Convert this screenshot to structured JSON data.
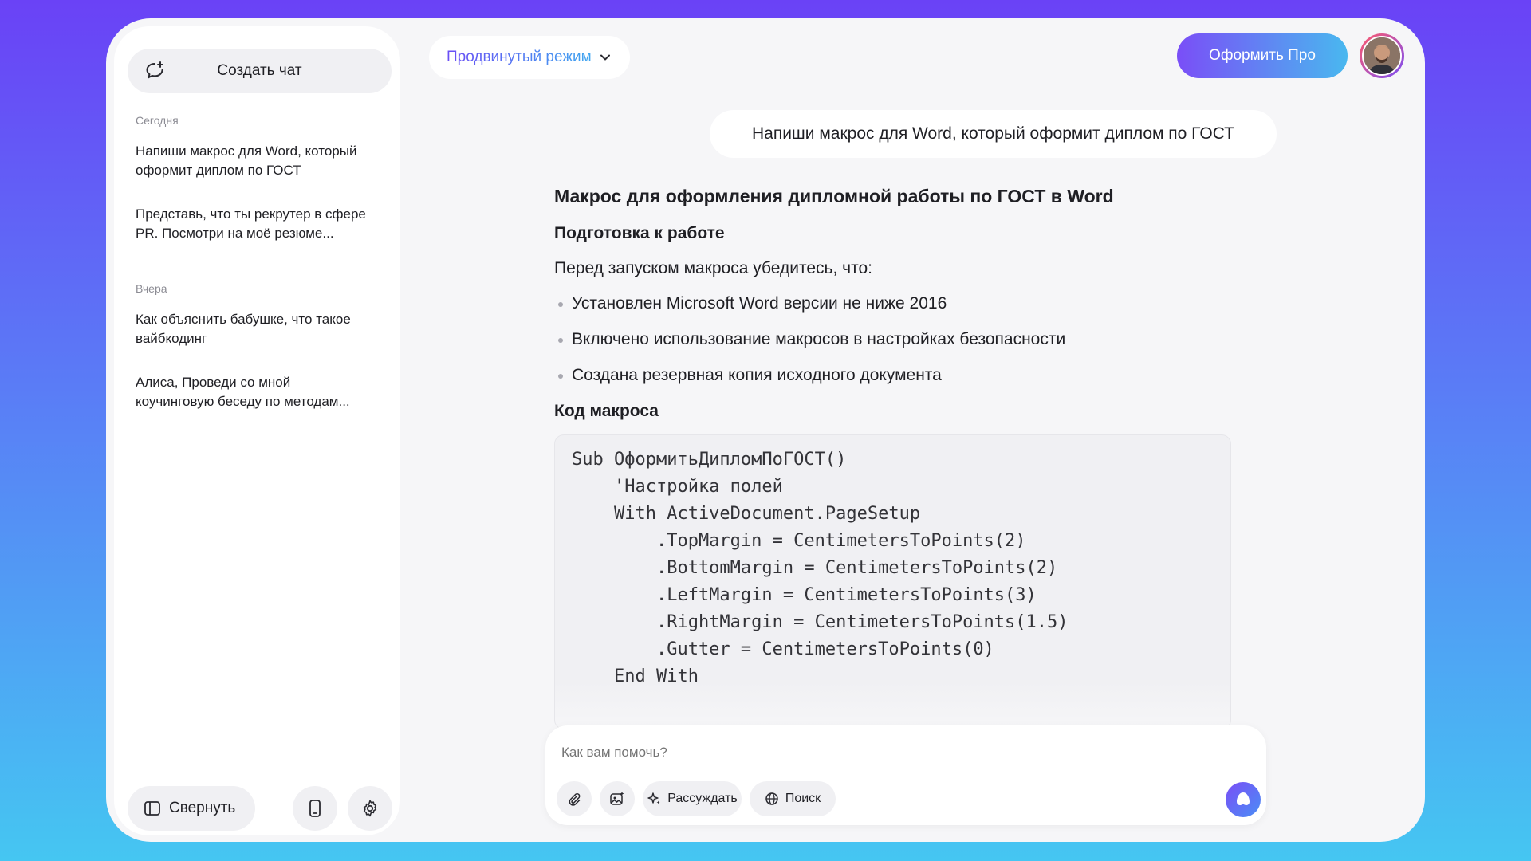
{
  "sidebar": {
    "new_chat_label": "Создать чат",
    "today_label": "Сегодня",
    "yesterday_label": "Вчера",
    "today_items": [
      {
        "line1": "Напиши макрос для Word, который",
        "line2": "оформит диплом по ГОСТ"
      },
      {
        "line1": "Представь, что ты рекрутер в сфере",
        "line2": "PR. Посмотри на моё резюме..."
      }
    ],
    "yesterday_items": [
      {
        "line1": "Как объяснить бабушке, что такое",
        "line2": "вайбкодинг"
      },
      {
        "line1": "Алиса, Проведи со мной",
        "line2": "коучинговую беседу по методам..."
      }
    ],
    "collapse_label": "Свернуть"
  },
  "header": {
    "mode_label": "Продвинутый режим",
    "pro_label": "Оформить Про"
  },
  "chat": {
    "user_message": "Напиши макрос для Word, который оформит диплом по ГОСТ",
    "answer": {
      "title": "Макрос для оформления дипломной работы по ГОСТ в Word",
      "section1": "Подготовка к работе",
      "intro": "Перед запуском макроса убедитесь, что:",
      "bullets": [
        "Установлен Microsoft Word версии не ниже 2016",
        "Включено использование макросов в настройках безопасности",
        "Создана резервная копия исходного документа"
      ],
      "section2": "Код макроса",
      "code": "Sub ОформитьДипломПоГОСТ()\n    'Настройка полей\n    With ActiveDocument.PageSetup\n        .TopMargin = CentimetersToPoints(2)\n        .BottomMargin = CentimetersToPoints(2)\n        .LeftMargin = CentimetersToPoints(3)\n        .RightMargin = CentimetersToPoints(1.5)\n        .Gutter = CentimetersToPoints(0)\n    End With"
    }
  },
  "input": {
    "placeholder": "Как вам помочь?",
    "reason_label": "Рассуждать",
    "search_label": "Поиск"
  },
  "icons": {
    "new_chat": "chat-plus-icon",
    "collapse": "sidebar-panel-icon",
    "phone": "phone-icon",
    "settings": "gear-icon",
    "chevron": "chevron-down-icon",
    "attach": "paperclip-icon",
    "image": "image-sparkle-icon",
    "reason": "sparkle-icon",
    "search": "globe-icon",
    "send": "alice-icon"
  }
}
